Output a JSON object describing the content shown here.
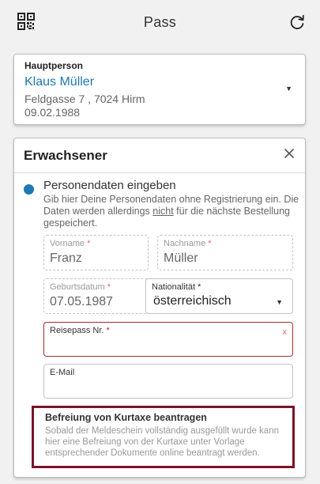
{
  "header": {
    "title": "Pass",
    "qr_icon": "qr-code-icon",
    "refresh_icon": "refresh-icon"
  },
  "main_person": {
    "label": "Hauptperson",
    "name": "Klaus Müller",
    "address": "Feldgasse 7 , 7024 Hirm",
    "birthdate": "09.02.1988"
  },
  "adult": {
    "title": "Erwachsener",
    "step_title": "Personendaten eingeben",
    "desc_part1": "Gib hier Deine Personendaten ohne Registrierung ein. Die Daten werden allerdings ",
    "desc_emph": "nicht",
    "desc_part2": " für die nächste Bestellung gespeichert.",
    "fields": {
      "first_name": {
        "label": "Vorname",
        "value": "Franz"
      },
      "last_name": {
        "label": "Nachname",
        "value": "Müller"
      },
      "birthdate": {
        "label": "Geburtsdatum",
        "value": "07.05.1987"
      },
      "nationality": {
        "label": "Nationalität",
        "value": "österreichisch"
      },
      "passport": {
        "label": "Reisepass Nr.",
        "value": "",
        "error_mark": "x"
      },
      "email": {
        "label": "E-Mail",
        "value": ""
      }
    },
    "required_mark": "*",
    "kurtaxe": {
      "title": "Befreiung von Kurtaxe beantragen",
      "text": "Sobald der Meldeschein vollständig ausgefüllt wurde kann hier eine Befreiung von der Kurtaxe unter Vorlage entsprechender Dokumente online beantragt werden."
    }
  },
  "colors": {
    "accent": "#1f78b4",
    "error": "#a62d2d",
    "highlight_border": "#7a1428"
  }
}
